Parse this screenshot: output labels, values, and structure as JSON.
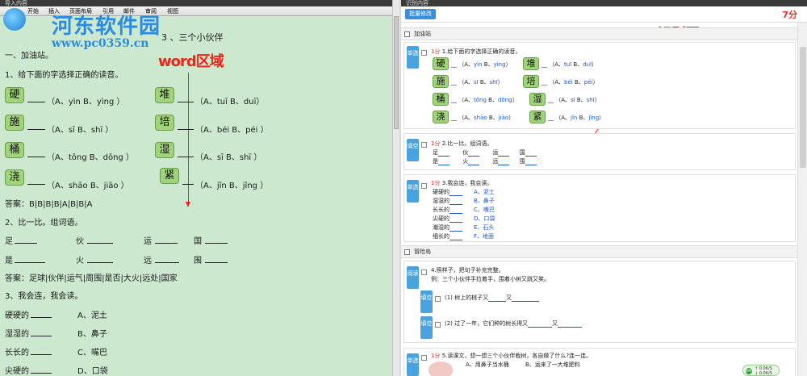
{
  "left": {
    "window_title": "导入内容",
    "menu": [
      "开始",
      "插入",
      "页面布局",
      "引用",
      "邮件",
      "审阅",
      "视图"
    ],
    "watermark_site": "河东软件园",
    "watermark_url": "www.pc0359.cn",
    "overlay_label": "word区域",
    "doc_title": "3 、三个小伙伴",
    "section1": "一、加油站。",
    "q1_text": "1、给下面的字选择正确的读音。",
    "q1_rows": [
      {
        "c1": "硬",
        "o1": "（A、yìn  B、yìng ）",
        "c2": "堆",
        "o2": "（A、tuī    B、duī）"
      },
      {
        "c1": "施",
        "o1": "（A、sī  B、shī ）",
        "c2": "培",
        "o2": "（A、béi  B、péi ）"
      },
      {
        "c1": "桶",
        "o1": "（A、tǒng  B、dǒng ）",
        "c2": "湿",
        "o2": "（A、sī  B、shī ）"
      },
      {
        "c1": "浇",
        "o1": "（A、shāo  B、jiāo ）",
        "c2": "紧",
        "o2": "（A、jǐn  B、jǐng ）"
      }
    ],
    "answer1": "答案：B|B|B|B|A|B|B|A",
    "q2_text": "2、比一比。组词语。",
    "q2_row1": [
      "足",
      "伙",
      "运",
      "国"
    ],
    "q2_row2": [
      "是",
      "火",
      "远",
      "围"
    ],
    "answer2": "答案：足球|伙伴|运气|周围|是否|大火|远处|国家",
    "q3_text": "3、我会连，我会读。",
    "q3_rows": [
      {
        "l": "硬硬的",
        "r": "A、泥土"
      },
      {
        "l": "湿湿的",
        "r": "B、鼻子"
      },
      {
        "l": "长长的",
        "r": "C、嘴巴"
      },
      {
        "l": "尖硬的",
        "r": "D、口袋"
      }
    ]
  },
  "right": {
    "window_title": "识别内容",
    "batch_button": "批量修改",
    "total_score": "7分",
    "overlay_label": "识别区",
    "section_a": "加油站",
    "section_b": "冒险岛",
    "q1": {
      "tag": "单选",
      "pts": "1分",
      "text": " 1.给下面的字选择正确的读音。",
      "rows": [
        {
          "c1": "硬",
          "a1": "yìn",
          "b1": "yìng",
          "c2": "堆",
          "a2": "tuī",
          "b2": "duī"
        },
        {
          "c1": "施",
          "a1": "sī",
          "b1": "shī",
          "c2": "培",
          "a2": "béi",
          "b2": "péi"
        },
        {
          "c1": "桶",
          "a1": "tǒng",
          "b1": "dǒng",
          "c2": "湿",
          "a2": "sī",
          "b2": "shī"
        },
        {
          "c1": "浇",
          "a1": "shāo",
          "b1": "jiāo",
          "c2": "紧",
          "a2": "jǐn",
          "b2": "jǐng"
        }
      ]
    },
    "q2": {
      "tag": "填空",
      "pts": "1分",
      "text": " 2.比一比。组词语。",
      "row1": [
        "足",
        "伙",
        "运",
        "国"
      ],
      "row2": [
        "是",
        "火",
        "远",
        "围"
      ]
    },
    "q3": {
      "tag": "单选",
      "pts": "1分",
      "text": " 3.我会连，我会读。",
      "rows": [
        {
          "l": "硬硬的",
          "r": "A、泥土"
        },
        {
          "l": "湿湿的",
          "r": "B、鼻子"
        },
        {
          "l": "长长的",
          "r": "C、嘴巴"
        },
        {
          "l": "尖硬的",
          "r": "D、口袋"
        },
        {
          "l": "潮湿的",
          "r": "E、石头"
        },
        {
          "l": "细长的",
          "r": "F、地面"
        }
      ]
    },
    "q4": {
      "tag": "阅读",
      "text": "4.照样子，把句子补充完整。",
      "example": "例：三个小伙伴手拉着手，围着小树又跳又笑。",
      "sub1_tag": "填空",
      "sub1": "(1) 树上的桃子又",
      "sub1_mid": "又",
      "sub2_tag": "填空",
      "sub2": "(2) 过了一年，它们种的树长得又",
      "sub2_mid": "又"
    },
    "q5": {
      "tag": "单选",
      "pts": "1分",
      "text": " 5.读课文，想一想三个小伙伴栽树，各自做了什么?连一连。",
      "opt1": "A、用鼻子当水桶",
      "opt2": "B、运来了一大堆肥料"
    },
    "status": {
      "up": "↑ 0.0K/S",
      "down": "↓ 0.0K/S",
      "pct": "64%"
    }
  }
}
